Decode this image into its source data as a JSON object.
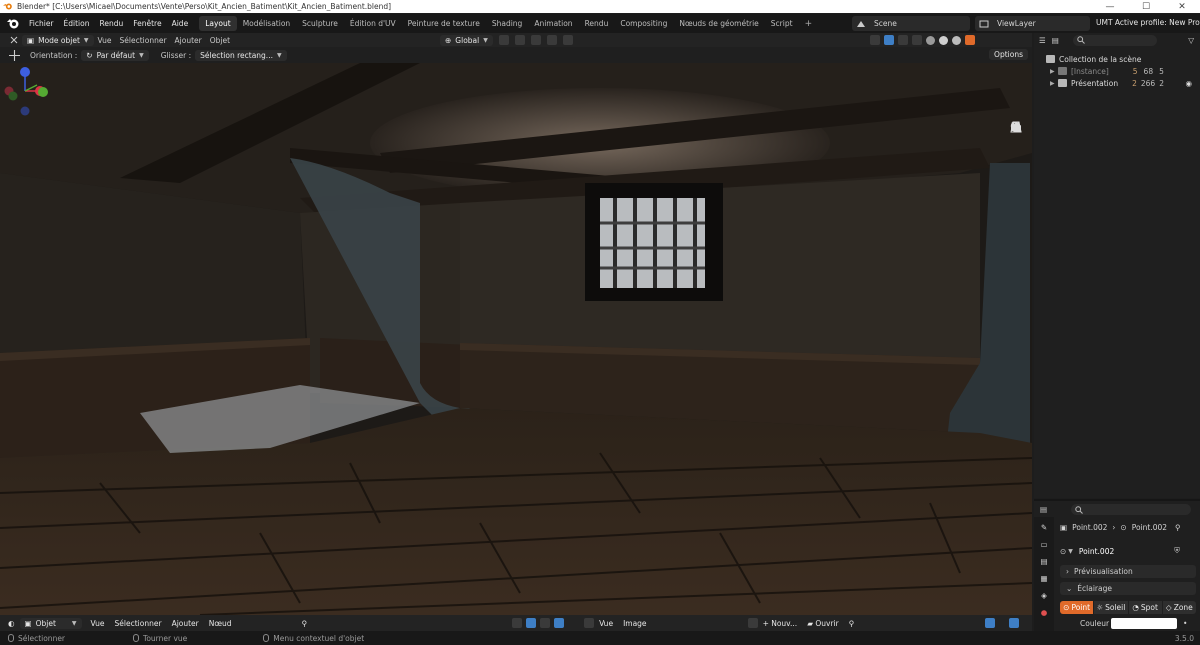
{
  "window": {
    "title": "Blender* [C:\\Users\\Micael\\Documents\\Vente\\Perso\\Kit_Ancien_Batiment\\Kit_Ancien_Batiment.blend]",
    "minimize": "—",
    "maximize": "☐",
    "close": "✕"
  },
  "menu": {
    "file": "Fichier",
    "edit": "Édition",
    "render": "Rendu",
    "window": "Fenêtre",
    "help": "Aide"
  },
  "workspaces": [
    {
      "label": "Layout",
      "active": true
    },
    {
      "label": "Modélisation"
    },
    {
      "label": "Sculpture"
    },
    {
      "label": "Édition d'UV"
    },
    {
      "label": "Peinture de texture"
    },
    {
      "label": "Shading"
    },
    {
      "label": "Animation"
    },
    {
      "label": "Rendu"
    },
    {
      "label": "Compositing"
    },
    {
      "label": "Nœuds de géométrie"
    },
    {
      "label": "Script"
    }
  ],
  "add_workspace": "+",
  "scene": {
    "name": "Scene"
  },
  "view_layer": {
    "name": "ViewLayer"
  },
  "umt_profile": "UMT Active profile: New Profile",
  "viewport_header": {
    "mode": "Mode objet",
    "view": "Vue",
    "select": "Sélectionner",
    "add": "Ajouter",
    "object": "Objet",
    "transform_orientation": "Global"
  },
  "tool_settings": {
    "orientation_label": "Orientation :",
    "orientation_value": "Par défaut",
    "drag_label": "Glisser :",
    "drag_value": "Sélection rectang...",
    "options": "Options"
  },
  "gizmo": {
    "x": "X",
    "y": "Y",
    "z": "Z"
  },
  "outliner": {
    "search_placeholder": "",
    "root": "Collection de la scène",
    "rows": [
      {
        "label": "[Instance]",
        "badges": [
          "5",
          "68",
          "5"
        ]
      },
      {
        "label": "Présentation",
        "badges": [
          "2",
          "266",
          "2"
        ]
      }
    ]
  },
  "properties": {
    "breadcrumb_object": "Point.002",
    "breadcrumb_data": "Point.002",
    "datablock": "Point.002",
    "sections": {
      "preview": "Prévisualisation",
      "lighting": "Éclairage"
    },
    "light_types": [
      "Point",
      "Soleil",
      "Spot",
      "Zone"
    ],
    "color_label": "Couleur",
    "color_value": "#ffffff"
  },
  "bottom_header": {
    "mode": "Objet",
    "view": "Vue",
    "select": "Sélectionner",
    "add": "Ajouter",
    "node": "Nœud",
    "view2": "Vue",
    "image": "Image",
    "new": "+ Nouv...",
    "open": "Ouvrir"
  },
  "status": {
    "select": "Sélectionner",
    "rotate": "Tourner vue",
    "context": "Menu contextuel d'objet",
    "version": "3.5.0"
  }
}
